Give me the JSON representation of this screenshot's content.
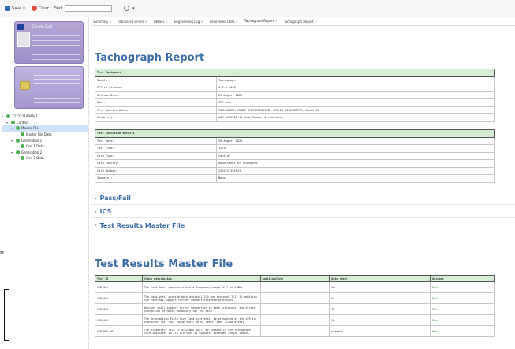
{
  "toolbar": {
    "save_label": "Save",
    "clear_label": "Clear",
    "find_label": "Find",
    "find_value": ""
  },
  "cards": {
    "front_title": "Control Card"
  },
  "tree": [
    {
      "label": "2222221494941",
      "level": 0,
      "toggle": "▾",
      "selected": false
    },
    {
      "label": "Contact",
      "level": 1,
      "toggle": "▾",
      "selected": false
    },
    {
      "label": "Master File",
      "level": 2,
      "toggle": "▾",
      "selected": true
    },
    {
      "label": "Master File Data",
      "level": 3,
      "toggle": "",
      "selected": false
    },
    {
      "label": "Generation 1",
      "level": 2,
      "toggle": "▾",
      "selected": false
    },
    {
      "label": "Gen 1 Data",
      "level": 3,
      "toggle": "",
      "selected": false
    },
    {
      "label": "Generation 2",
      "level": 2,
      "toggle": "▾",
      "selected": false
    },
    {
      "label": "Gen 2 Data",
      "level": 3,
      "toggle": "",
      "selected": false
    }
  ],
  "tabs": [
    {
      "label": "Summary",
      "active": false
    },
    {
      "label": "Tabulated Errors",
      "active": false
    },
    {
      "label": "Details",
      "active": false
    },
    {
      "label": "Engineering Log",
      "active": false
    },
    {
      "label": "Recovered Data",
      "active": false
    },
    {
      "label": "Tachograph Report",
      "active": true
    },
    {
      "label": "Tachograph Report",
      "active": false
    }
  ],
  "report": {
    "title": "Tachograph Report",
    "equipment_header": "Test Equipment",
    "equipment": [
      [
        "Module:",
        "Tachograph"
      ],
      [
        "CPT v4 Version:",
        "4.3.0.1098"
      ],
      [
        "Release Date:",
        "29 August 2025"
      ],
      [
        "User:",
        "CPT User"
      ],
      [
        "Test Specification:",
        "TACHOGRAPH CARDS SPECIFICATION- CEN/EN_2281988799, Annex 1C"
      ],
      [
        "Reader(s):",
        "ACS ACR1502 15 Dual Reader 0 (Contact)"
      ]
    ],
    "execution_header": "Test Execution details",
    "execution": [
      [
        "Test Date:",
        "29 August 2025"
      ],
      [
        "Test Time:",
        "12:01"
      ],
      [
        "Card Type:",
        "Control"
      ],
      [
        "Card Country:",
        "Department of Transport"
      ],
      [
        "Card Number:",
        "2222221494941"
      ],
      [
        "Image(s):",
        "None"
      ]
    ]
  },
  "sections": [
    {
      "label": "Pass/Fail",
      "marker": "▸"
    },
    {
      "label": "ICS",
      "marker": "▸"
    },
    {
      "label": "Test Results Master File",
      "marker": "▾"
    }
  ],
  "results": {
    "title": "Test Results Master File",
    "columns": [
      "Test ID",
      "Check description",
      "Applicability",
      "Data (hex)",
      "Outcome"
    ],
    "rows": [
      [
        "ATR_001",
        "The card shall operate within a frequency range of 1 to 5 MHz",
        "",
        "00",
        "Pass"
      ],
      [
        "ATR_002",
        "The card shall provide both protocol T=0 and protocol T=1. In addition the card may support further contact-oriented protocols",
        "",
        "01",
        "Pass"
      ],
      [
        "ATR_003",
        "Devices shall support direct convention in both protocols: the direct convention is hence mandatory for the card",
        "",
        "3B",
        "Pass"
      ],
      [
        "ATR_004",
        "The Information Field Size Card byte shall be presented at the ATR in character TA3. This value shall be at least 'F0h' (=240 bytes)",
        "",
        "F0",
        "Pass"
      ],
      [
        "ATRINFO_001",
        "The elementary file EF ATR/INFO shall be present if the tachograph card indicates in its ATR that it supports extended length fields.",
        "",
        "present",
        "Pass"
      ]
    ]
  },
  "margin": {
    "letter": "n"
  }
}
